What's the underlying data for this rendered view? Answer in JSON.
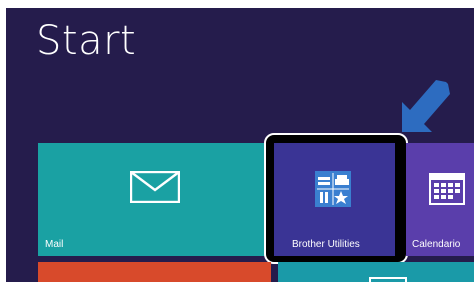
{
  "screen": {
    "title": "Start",
    "background_color": "#251c4c"
  },
  "tiles": [
    {
      "label": "Mail",
      "color": "#1aa1a3",
      "icon": "mail-icon"
    },
    {
      "label": "Brother Utilities",
      "color": "#3a3495",
      "icon": "brother-utilities-icon",
      "highlighted": true
    },
    {
      "label": "Calendario",
      "color": "#5a3eab",
      "icon": "calendar-icon"
    },
    {
      "label": "",
      "color": "#d84a2b",
      "icon": "partial-icon"
    },
    {
      "label": "",
      "color": "#1a9aa8",
      "icon": "partial-icon"
    }
  ],
  "annotation": {
    "arrow_color": "#2d6cc0",
    "arrow_icon": "pointer-arrow-icon"
  }
}
